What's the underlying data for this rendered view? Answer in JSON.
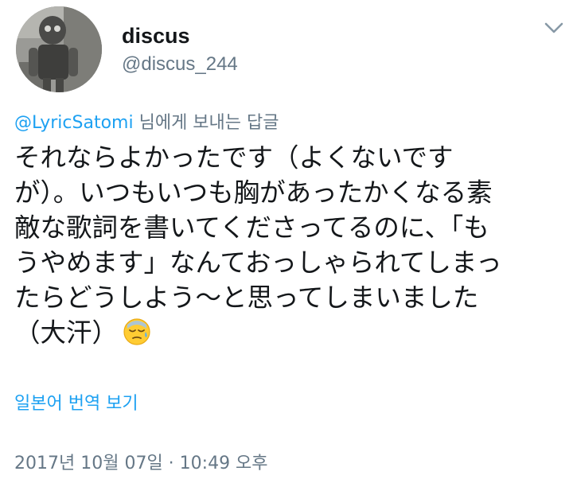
{
  "user": {
    "display_name": "discus",
    "handle": "@discus_244",
    "avatar_icon": "robot-avatar"
  },
  "menu": {
    "icon": "chevron-down-icon"
  },
  "reply": {
    "mention": "@LyricSatomi",
    "suffix": " 님에게 보내는 답글"
  },
  "tweet": {
    "text": "それならよかったです（よくないです\nが）。いつもいつも胸があったかくなる素\n敵な歌詞を書いてくださってるのに、「も\nうやめます」なんておっしゃられてしまっ\nたらどうしよう〜と思ってしまいました\n（大汗）",
    "emoji": "sweat-face-emoji"
  },
  "actions": {
    "translate_label": "일본어 번역 보기"
  },
  "meta": {
    "timestamp": "2017년 10월 07일 · 10:49 오후"
  },
  "colors": {
    "link": "#1da1f2",
    "secondary": "#657786",
    "text": "#14171a"
  }
}
